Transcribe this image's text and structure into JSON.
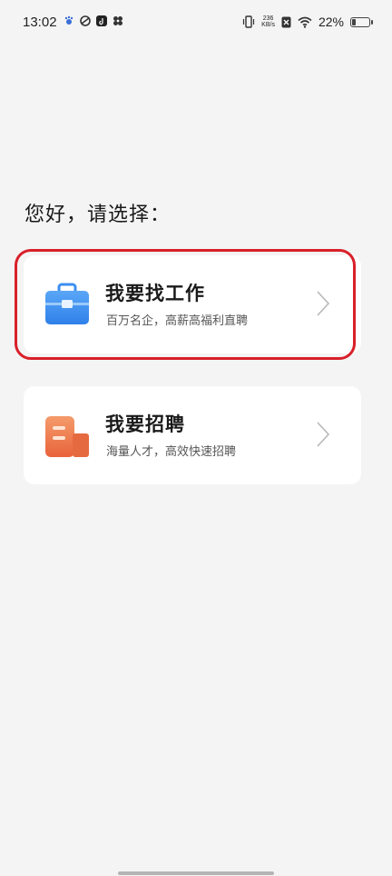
{
  "status_bar": {
    "time": "13:02",
    "net_speed_value": "236",
    "net_speed_unit": "KB/s",
    "battery_percent": "22%",
    "battery_level": 0.22,
    "icons": [
      "baidu-icon",
      "app-swirl-icon",
      "tiktok-icon",
      "fan-icon",
      "vibrate-icon",
      "sim-off-icon",
      "wifi-icon",
      "battery-icon"
    ]
  },
  "greeting": "您好，请选择：",
  "options": [
    {
      "title": "我要找工作",
      "subtitle": "百万名企，高薪高福利直聘",
      "icon": "briefcase-icon",
      "accent": "#3b8ef0",
      "highlighted": true
    },
    {
      "title": "我要招聘",
      "subtitle": "海量人才，高效快速招聘",
      "icon": "building-icon",
      "accent": "#ef7a4a",
      "highlighted": false
    }
  ],
  "colors": {
    "background": "#f4f4f4",
    "card": "#ffffff",
    "highlight": "#d9202a"
  }
}
